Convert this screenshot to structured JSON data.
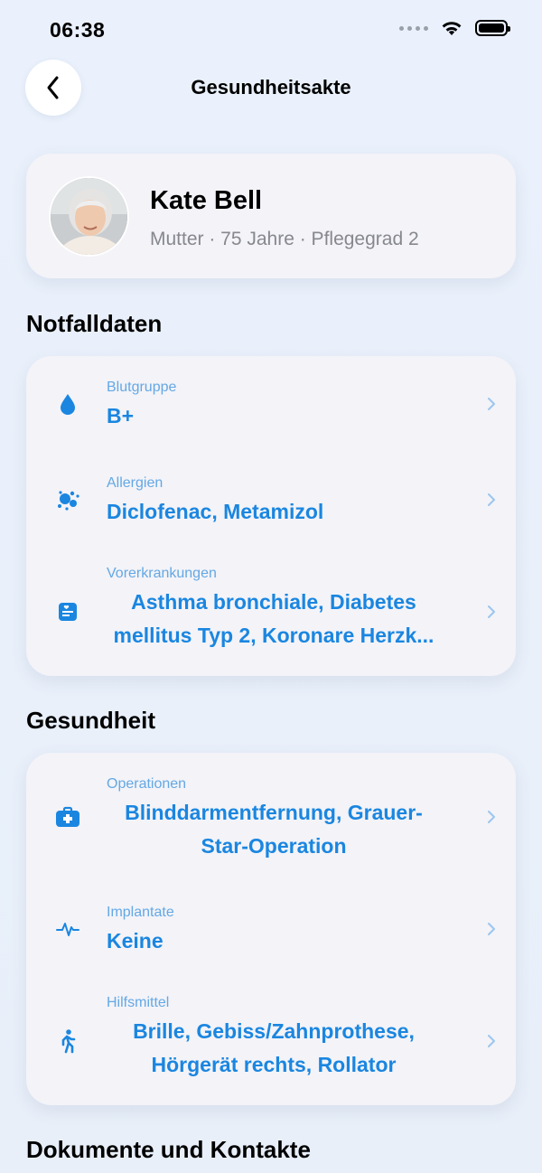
{
  "status": {
    "time": "06:38"
  },
  "nav": {
    "title": "Gesundheitsakte"
  },
  "profile": {
    "name": "Kate Bell",
    "subtitle": "Mutter · 75 Jahre · Pflegegrad 2"
  },
  "sections": {
    "emergency": {
      "title": "Notfalldaten",
      "rows": [
        {
          "label": "Blutgruppe",
          "value": "B+",
          "icon": "drop-icon"
        },
        {
          "label": "Allergien",
          "value": "Diclofenac, Metamizol",
          "icon": "allergens-icon"
        },
        {
          "label": "Vorerkrankungen",
          "value": "Asthma bronchiale, Diabetes mellitus Typ 2, Koronare Herzk...",
          "icon": "medical-record-icon"
        }
      ]
    },
    "health": {
      "title": "Gesundheit",
      "rows": [
        {
          "label": "Operationen",
          "value": "Blinddarmentfernung, Grauer-Star-Operation",
          "icon": "medical-kit-icon"
        },
        {
          "label": "Implantate",
          "value": "Keine",
          "icon": "heartbeat-icon"
        },
        {
          "label": "Hilfsmittel",
          "value": "Brille, Gebiss/Zahnprothese, Hörgerät rechts, Rollator",
          "icon": "walking-person-icon"
        }
      ]
    },
    "documents": {
      "title": "Dokumente und Kontakte"
    }
  },
  "colors": {
    "accent": "#1a86e0",
    "label": "#64a8e4",
    "card": "#f3f3f8",
    "background": "#e9f0fb"
  }
}
